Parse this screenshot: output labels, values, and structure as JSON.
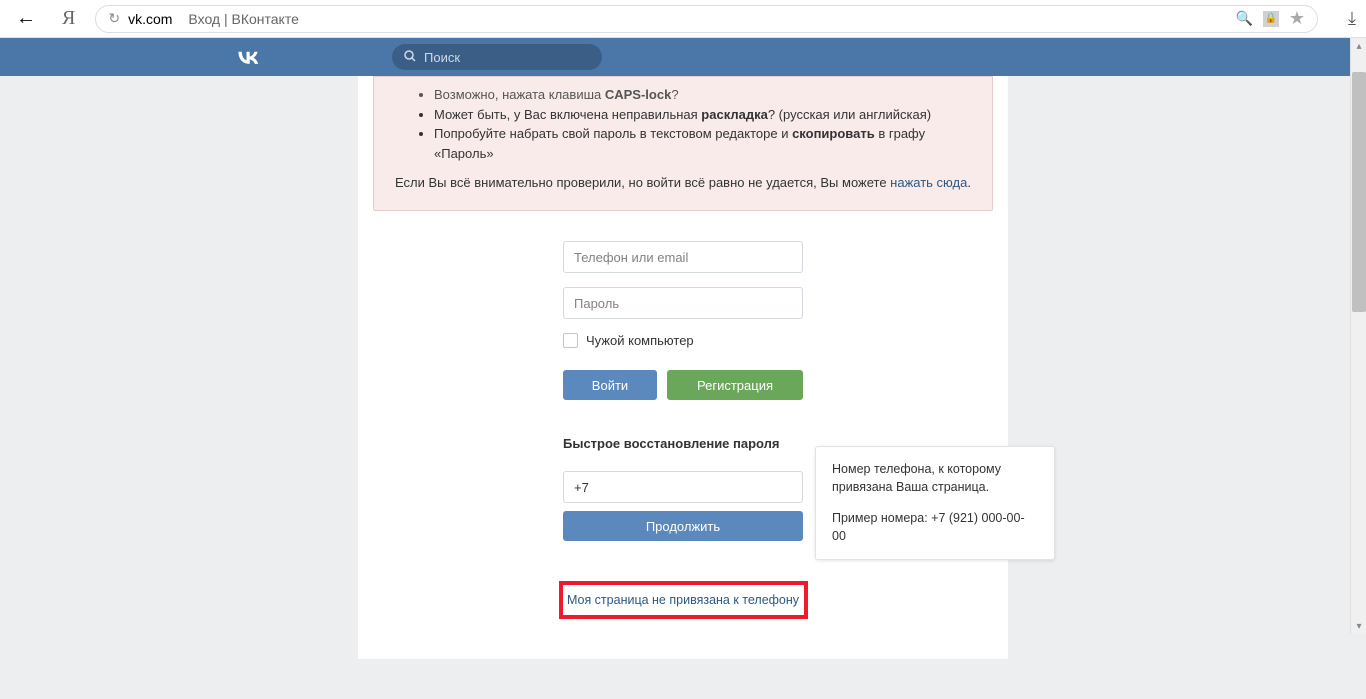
{
  "browser": {
    "url_domain": "vk.com",
    "url_title": "Вход | ВКонтакте",
    "yandex_char": "Я"
  },
  "header": {
    "logo": "VK",
    "search_placeholder": "Поиск"
  },
  "warning": {
    "items": [
      {
        "text_pre": "Возможно, нажата клавиша ",
        "bold": "CAPS-lock",
        "text_post": "?",
        "cut": true
      },
      {
        "text_pre": "Может быть, у Вас включена неправильная ",
        "bold": "раскладка",
        "text_post": "? (русская или английская)"
      },
      {
        "text_pre": "Попробуйте набрать свой пароль в текстовом редакторе и ",
        "bold": "скопировать",
        "text_post": " в графу «Пароль»"
      }
    ],
    "footer_pre": "Если Вы всё внимательно проверили, но войти всё равно не удается, Вы можете ",
    "footer_link": "нажать сюда",
    "footer_post": "."
  },
  "login": {
    "login_placeholder": "Телефон или email",
    "password_placeholder": "Пароль",
    "foreign_pc": "Чужой компьютер",
    "login_btn": "Войти",
    "register_btn": "Регистрация"
  },
  "recovery": {
    "title": "Быстрое восстановление пароля",
    "phone_value": "+7",
    "continue_btn": "Продолжить",
    "tooltip_line1": "Номер телефона, к которому привязана Ваша страница.",
    "tooltip_line2": "Пример номера: +7 (921) 000-00-00",
    "no_phone_link": "Моя страница не привязана к телефону"
  }
}
